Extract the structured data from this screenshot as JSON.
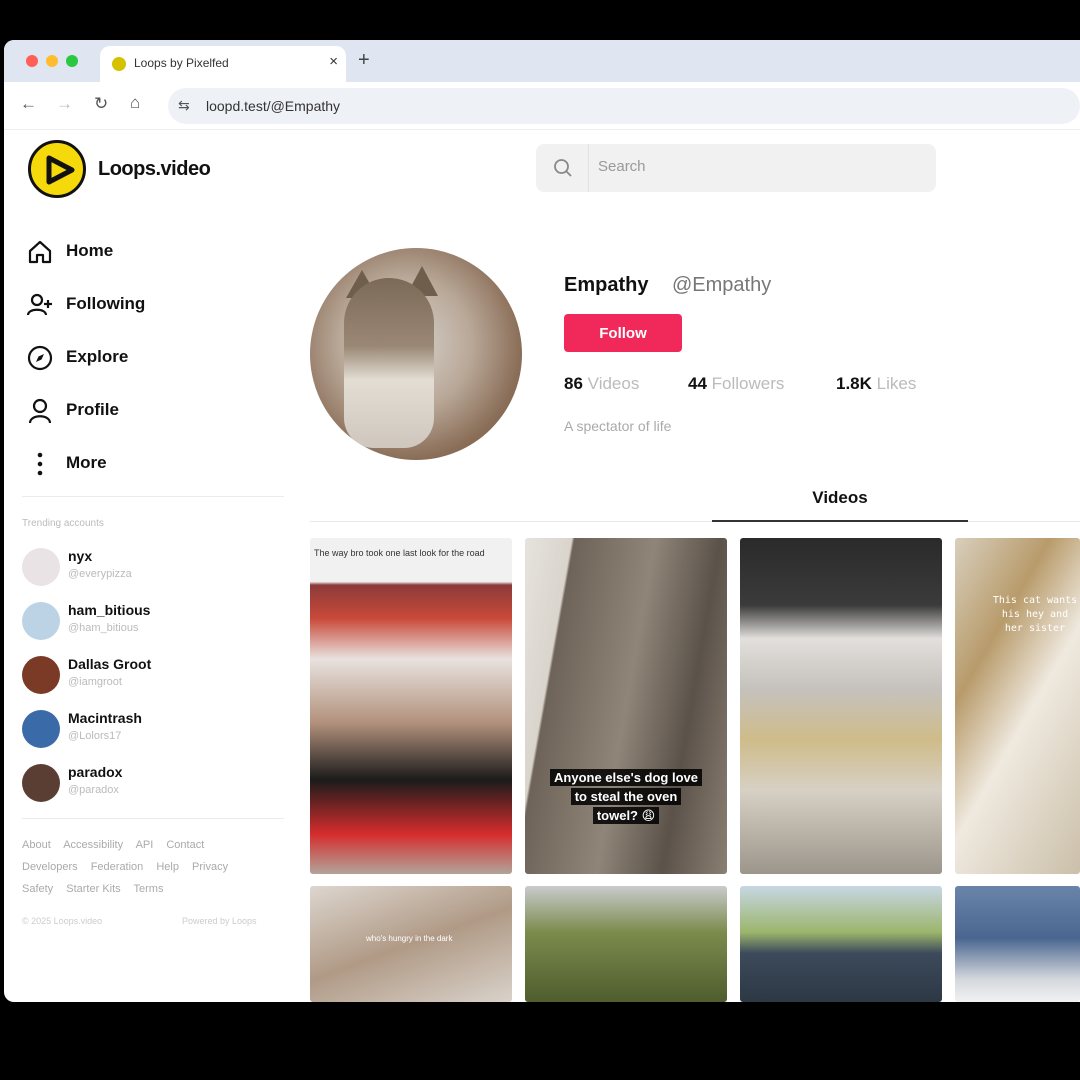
{
  "browser": {
    "tab_title": "Loops by Pixelfed",
    "tab_close": "×",
    "new_tab": "+",
    "url": "loopd.test/@Empathy"
  },
  "brand": {
    "name": "Loops.video"
  },
  "search": {
    "placeholder": "Search"
  },
  "menu": [
    {
      "label": "Home",
      "icon": "home-icon"
    },
    {
      "label": "Following",
      "icon": "add-user-icon"
    },
    {
      "label": "Explore",
      "icon": "compass-icon"
    },
    {
      "label": "Profile",
      "icon": "user-icon"
    },
    {
      "label": "More",
      "icon": "more-vertical-icon"
    }
  ],
  "trending": {
    "heading": "Trending accounts",
    "accounts": [
      {
        "name": "nyx",
        "handle": "@everypizza",
        "color": "#e9e3e5"
      },
      {
        "name": "ham_bitious",
        "handle": "@ham_bitious",
        "color": "#bcd3e6"
      },
      {
        "name": "Dallas Groot",
        "handle": "@iamgroot",
        "color": "#7a3a25"
      },
      {
        "name": "Macintrash",
        "handle": "@Lolors17",
        "color": "#3b6aa8"
      },
      {
        "name": "paradox",
        "handle": "@paradox",
        "color": "#5a3d33"
      }
    ]
  },
  "footer": {
    "links": [
      "About",
      "Accessibility",
      "API",
      "Contact",
      "Developers",
      "Federation",
      "Help",
      "Privacy",
      "Safety",
      "Starter Kits",
      "Terms"
    ],
    "copyright": "© 2025 Loops.video",
    "powered": "Powered by Loops"
  },
  "profile": {
    "display_name": "Empathy",
    "handle": "@Empathy",
    "follow_label": "Follow",
    "stats": {
      "videos_count": "86",
      "videos_label": "Videos",
      "followers_count": "44",
      "followers_label": "Followers",
      "likes_count": "1.8K",
      "likes_label": "Likes"
    },
    "bio": "A spectator of life"
  },
  "tabs": {
    "videos": "Videos"
  },
  "videos": [
    {
      "top_text": "The way bro took one last look for the road",
      "caption": ""
    },
    {
      "caption_lines": [
        "Anyone else's dog love",
        "to steal the oven",
        "towel? 😩"
      ]
    },
    {
      "caption": ""
    },
    {
      "overlay_lines": [
        "This cat wants",
        "his hey and",
        "her sister"
      ]
    },
    {
      "overlay": "who's hungry in the dark"
    },
    {
      "caption": ""
    },
    {
      "caption": ""
    },
    {
      "caption": ""
    }
  ],
  "colors": {
    "accent": "#f0295a",
    "logo": "#f5d90a"
  }
}
